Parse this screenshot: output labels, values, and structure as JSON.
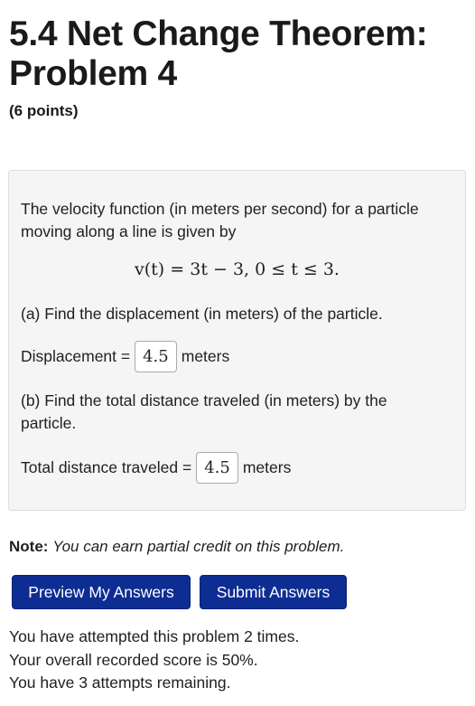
{
  "header": {
    "title": "5.4 Net Change Theorem: Problem 4",
    "points": "(6 points)"
  },
  "problem": {
    "intro_line1": "The velocity function (in meters per second) for a particle",
    "intro_line2": "moving along a line is given by",
    "equation_lhs": "v(t)",
    "equation_rhs": "= 3t − 3,  0 ≤ t ≤ 3.",
    "part_a": "(a) Find the displacement (in meters) of the particle.",
    "part_a_label": "Displacement =",
    "part_a_value": "4.5",
    "part_a_unit": "meters",
    "part_b_line1": "(b) Find the total distance traveled (in meters) by the",
    "part_b_line2": "particle.",
    "part_b_label": "Total distance traveled =",
    "part_b_value": "4.5",
    "part_b_unit": "meters"
  },
  "note": {
    "label": "Note:",
    "text": "You can earn partial credit on this problem."
  },
  "buttons": {
    "preview": "Preview My Answers",
    "submit": "Submit Answers"
  },
  "status": {
    "attempts": "You have attempted this problem 2 times.",
    "score": "Your overall recorded score is 50%.",
    "remaining": "You have 3 attempts remaining."
  },
  "colors": {
    "button_bg": "#0e2d93",
    "button_text": "#ffffff",
    "panel_bg": "#f5f5f5"
  }
}
